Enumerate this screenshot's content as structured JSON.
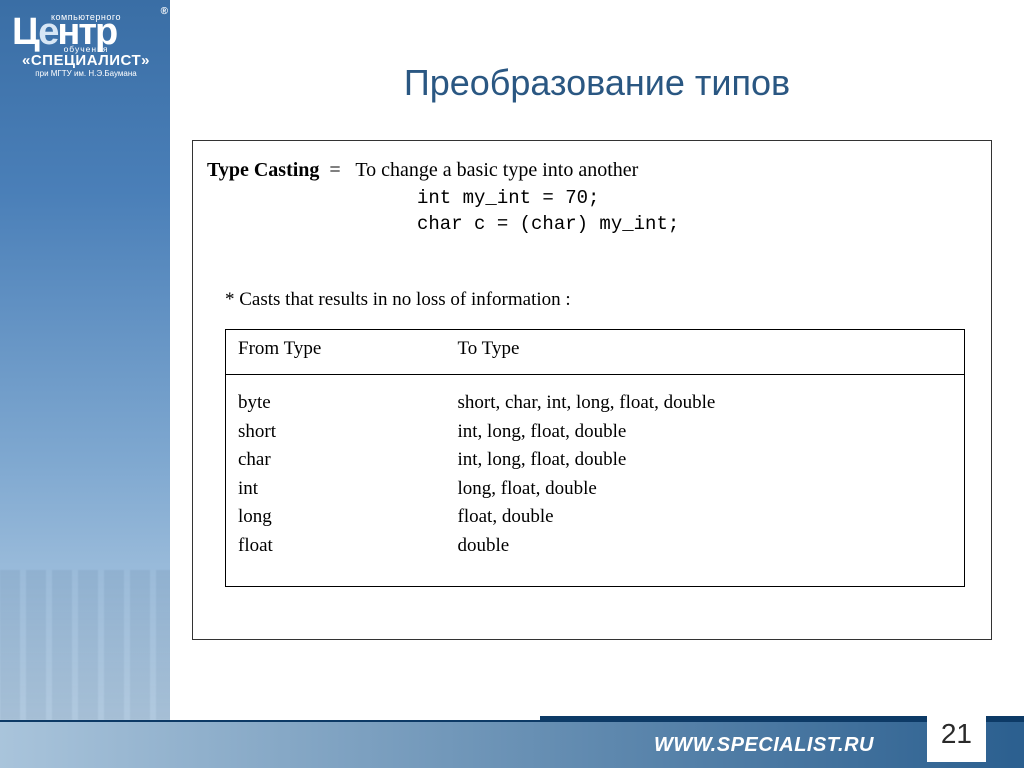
{
  "logo": {
    "top_small": "компьютерного",
    "main_html": "Центр",
    "mid_small": "обучения",
    "specialist": "«СПЕЦИАЛИСТ»",
    "affil": "при МГТУ им. Н.Э.Баумана",
    "reg": "®"
  },
  "title": "Преобразование типов",
  "type_casting": {
    "label": "Type Casting",
    "eq": "=",
    "desc": "To change a basic type into another",
    "code1": "int my_int = 70;",
    "code2": "char c = (char) my_int;"
  },
  "note": "* Casts that results in no loss of information :",
  "chart_data": {
    "type": "table",
    "columns": [
      "From Type",
      "To Type"
    ],
    "rows": [
      [
        "byte",
        "short, char, int, long, float, double"
      ],
      [
        "short",
        "int, long, float, double"
      ],
      [
        "char",
        "int, long, float, double"
      ],
      [
        "int",
        "long, float, double"
      ],
      [
        "long",
        "float, double"
      ],
      [
        "float",
        "double"
      ]
    ]
  },
  "footer": {
    "url": "WWW.SPECIALIST.RU",
    "page": "21"
  }
}
